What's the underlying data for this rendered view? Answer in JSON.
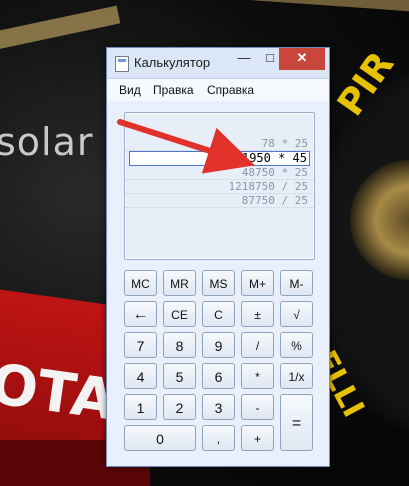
{
  "window": {
    "title": "Калькулятор",
    "controls": {
      "minimize": "—",
      "maximize": "□",
      "close": "✕"
    }
  },
  "menu": {
    "items": [
      "Вид",
      "Правка",
      "Справка"
    ]
  },
  "display": {
    "history": [
      "78 * 25",
      "1950 * 45",
      "48750 * 25",
      "1218750 / 25",
      "87750 / 25"
    ],
    "active_index": 1
  },
  "background": {
    "sponsor_text": "solar",
    "wing_text": "OTA",
    "tire_text_top": "PIR",
    "tire_text_bottom": "ELLI"
  },
  "keys": {
    "row1": [
      "MC",
      "MR",
      "MS",
      "M+",
      "M-"
    ],
    "row2": [
      "←",
      "CE",
      "C",
      "±",
      "√"
    ],
    "row3": [
      "7",
      "8",
      "9",
      "/",
      "%"
    ],
    "row4": [
      "4",
      "5",
      "6",
      "*",
      "1/x"
    ],
    "row5": [
      "1",
      "2",
      "3",
      "-",
      "="
    ],
    "row6": [
      "0",
      ",",
      "+"
    ]
  },
  "annotation": {
    "arrow_color": "#e0312a"
  }
}
